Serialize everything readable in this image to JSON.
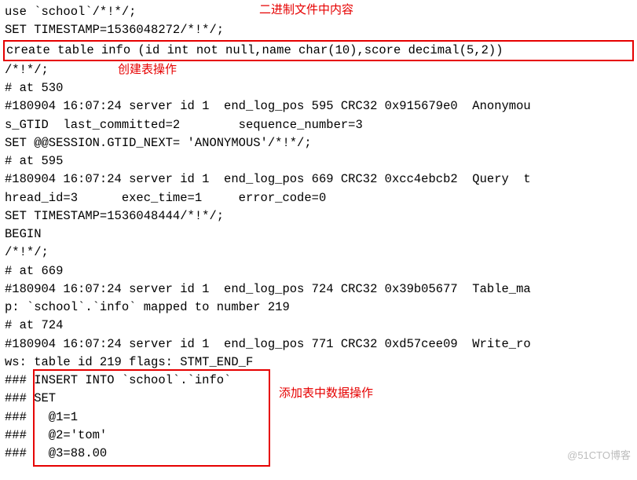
{
  "annotations": {
    "title_top": "二进制文件中内容",
    "create_label": "创建表操作",
    "insert_label": "添加表中数据操作"
  },
  "lines": {
    "l01": "use `school`/*!*/;",
    "l02": "SET TIMESTAMP=1536048272/*!*/;",
    "l03": "create table info (id int not null,name char(10),score decimal(5,2))",
    "l04": "/*!*/;",
    "l05": "# at 530",
    "l06": "#180904 16:07:24 server id 1  end_log_pos 595 CRC32 0x915679e0  Anonymou",
    "l07": "s_GTID  last_committed=2        sequence_number=3",
    "l08": "SET @@SESSION.GTID_NEXT= 'ANONYMOUS'/*!*/;",
    "l09": "# at 595",
    "l10": "#180904 16:07:24 server id 1  end_log_pos 669 CRC32 0xcc4ebcb2  Query  t",
    "l11": "hread_id=3      exec_time=1     error_code=0",
    "l12": "SET TIMESTAMP=1536048444/*!*/;",
    "l13": "BEGIN",
    "l14": "/*!*/;",
    "l15": "# at 669",
    "l16": "#180904 16:07:24 server id 1  end_log_pos 724 CRC32 0x39b05677  Table_ma",
    "l17": "p: `school`.`info` mapped to number 219",
    "l18": "# at 724",
    "l19": "#180904 16:07:24 server id 1  end_log_pos 771 CRC32 0xd57cee09  Write_ro",
    "l20": "ws: table id 219 flags: STMT_END_F",
    "l21": "### INSERT INTO `school`.`info`",
    "l22": "### SET",
    "l23": "###   @1=1",
    "l24": "###   @2='tom'",
    "l25": "###   @3=88.00"
  },
  "watermark": "@51CTO博客"
}
